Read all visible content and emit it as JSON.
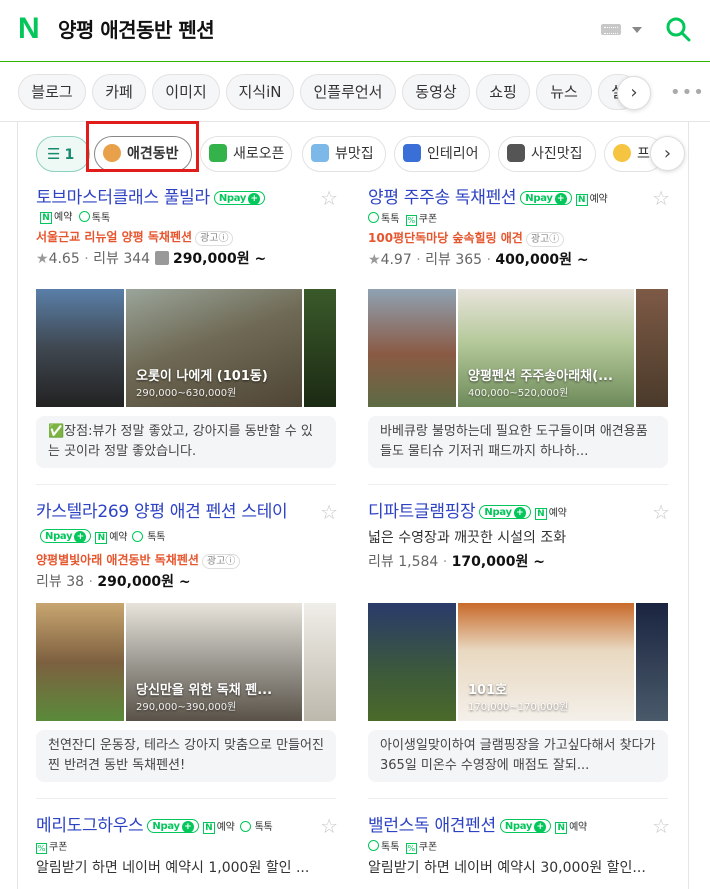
{
  "header": {
    "logo": "N",
    "query": "양평 애견동반 펜션"
  },
  "tabs": [
    "블로그",
    "카페",
    "이미지",
    "지식iN",
    "인플루언서",
    "동영상",
    "쇼핑",
    "뉴스",
    "실"
  ],
  "filters": {
    "filter_count": "1",
    "chips": [
      "애견동반",
      "새로오픈",
      "뷰맛집",
      "인테리어",
      "사진맛집",
      "프"
    ]
  },
  "labels": {
    "npay": "pay",
    "reserve": "예약",
    "talk": "톡톡",
    "coupon": "쿠폰",
    "ad": "광고ⓘ",
    "review": "리뷰",
    "won": "원 ~"
  },
  "cards": [
    {
      "title": "토브마스터클래스 풀빌라",
      "tags": [
        "톡톡"
      ],
      "ad": "서울근교 리뉴얼 양평 독채펜션",
      "rating": "4.65",
      "reviews": "344",
      "price": "290,000",
      "photo_caption": "오롯이 나에게 (101동)",
      "photo_price": "290,000~630,000원",
      "review_text": "✅장점:뷰가 정말 좋았고, 강아지를 동반할 수 있는 곳이라 정말 좋았습니다."
    },
    {
      "title": "양평 주주송 독채펜션",
      "tags": [
        "톡톡",
        "쿠폰"
      ],
      "ad": "100평단독마당 숲속힐링 애견",
      "rating": "4.97",
      "reviews": "365",
      "price": "400,000",
      "photo_caption": "양평펜션 주주송아래채(...",
      "photo_price": "400,000~520,000원",
      "review_text": "바베큐랑 불멍하는데 필요한 도구들이며 애견용품들도 물티슈 기저귀 패드까지 하나하..."
    },
    {
      "title": "카스텔라269 양평 애견 펜션 스테이",
      "tags": [],
      "ad": "양평별빛아래 애견동반 독채펜션",
      "rating": "",
      "reviews": "38",
      "price": "290,000",
      "photo_caption": "당신만을 위한 독채 펜...",
      "photo_price": "290,000~390,000원",
      "review_text": "천연잔디 운동장, 테라스 강아지 맞춤으로 만들어진 찐 반려견 동반 독채펜션!"
    },
    {
      "title": "디파트글램핑장",
      "tags": [],
      "desc": "넓은 수영장과 깨끗한 시설의 조화",
      "rating": "",
      "reviews": "1,584",
      "price": "170,000",
      "photo_caption": "101호",
      "photo_price": "170,000~170,000원",
      "review_text": "아이생일맞이하여 글램핑장을 가고싶다해서 찾다가 365일 미온수 수영장에 매점도 잘되..."
    },
    {
      "title": "메리도그하우스",
      "tags": [
        "쿠폰"
      ],
      "desc": "알림받기 하면 네이버 예약시 1,000원 할인 ..."
    },
    {
      "title": "밸런스독 애견펜션",
      "tags": [
        "톡톡",
        "쿠폰"
      ],
      "desc": "알림받기 하면 네이버 예약시 30,000원 할인..."
    }
  ]
}
